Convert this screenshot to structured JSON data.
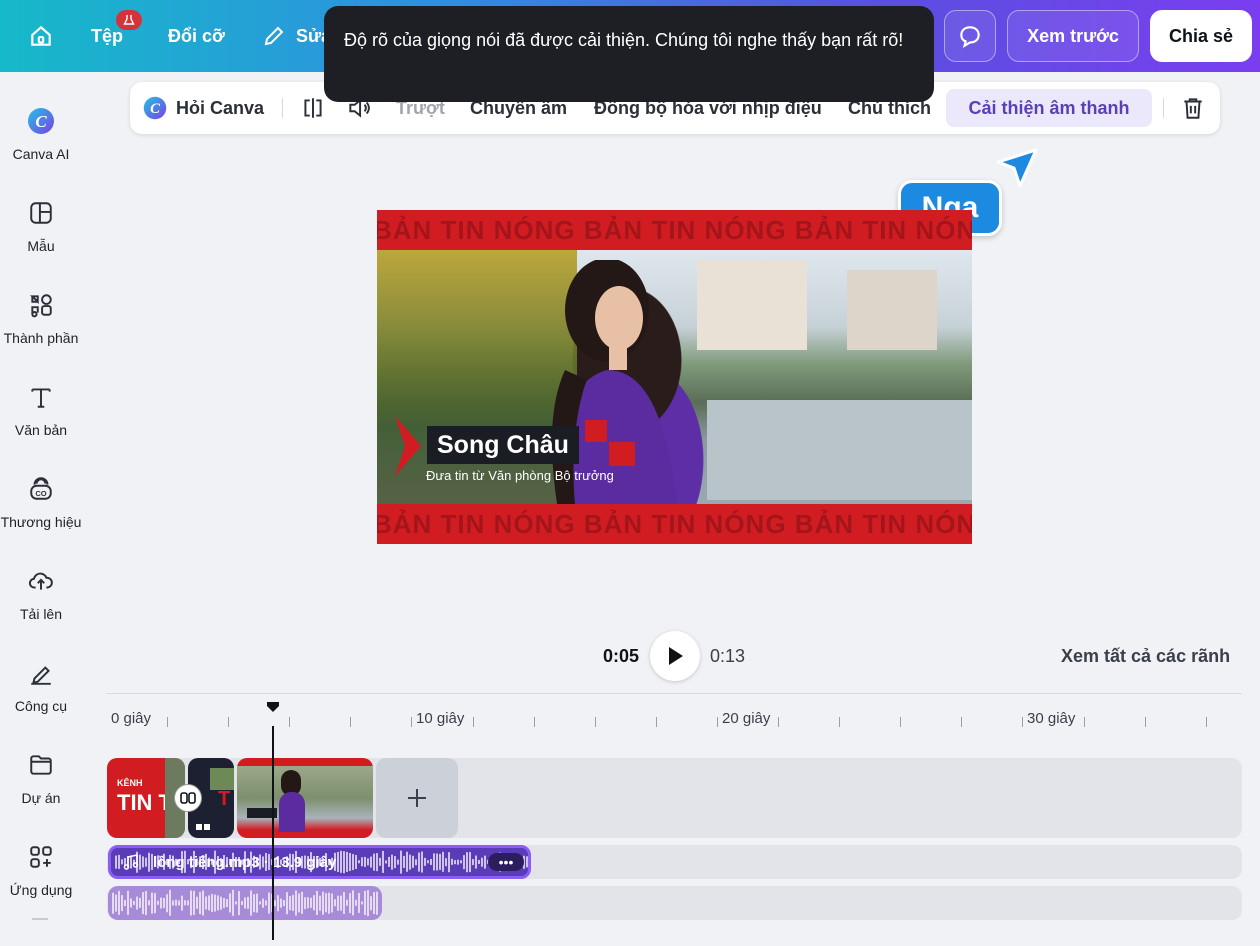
{
  "topbar": {
    "file_label": "Tệp",
    "resize_label": "Đổi cỡ",
    "edit_label": "Sửa",
    "preview_label": "Xem trước",
    "share_label": "Chia sẻ"
  },
  "toast": {
    "message": "Độ rõ của giọng nói đã được cải thiện. Chúng tôi nghe thấy bạn rất rõ!"
  },
  "sidebar": {
    "items": [
      {
        "label": "Canva AI",
        "icon": "canva-ai-icon"
      },
      {
        "label": "Mẫu",
        "icon": "template-icon"
      },
      {
        "label": "Thành phần",
        "icon": "elements-icon"
      },
      {
        "label": "Văn bản",
        "icon": "text-icon"
      },
      {
        "label": "Thương hiệu",
        "icon": "brand-icon"
      },
      {
        "label": "Tải lên",
        "icon": "upload-icon"
      },
      {
        "label": "Công cụ",
        "icon": "tools-icon"
      },
      {
        "label": "Dự án",
        "icon": "folder-icon"
      },
      {
        "label": "Ứng dụng",
        "icon": "apps-icon"
      }
    ]
  },
  "context_toolbar": {
    "ask_canva": "Hỏi Canva",
    "slide": "Trượt",
    "transcribe": "Chuyển âm",
    "beat_sync": "Đồng bộ hóa với nhịp điệu",
    "captions": "Chú thích",
    "enhance_audio": "Cải thiện âm thanh"
  },
  "collaborator": {
    "name": "Nga",
    "color": "#1c8ae0"
  },
  "canvas": {
    "band_text": "BẢN TIN NÓNG BẢN TIN NÓNG BẢN TIN NÓNG",
    "name": "Song Châu",
    "subtitle": "Đưa tin từ Văn phòng Bộ trưởng",
    "accent": "#d11c22"
  },
  "playback": {
    "current": "0:05",
    "total": "0:13",
    "see_all": "Xem tất cả các rãnh"
  },
  "timeline": {
    "labels": [
      "0 giây",
      "10 giây",
      "20 giây",
      "30 giây"
    ],
    "clip1_text": "TIN T",
    "clip1_small": "KÊNH",
    "audio_name": "lồng tiếng.mp3",
    "audio_duration": "13.9 giây",
    "audio_label": "lồng tiếng.mp3 · 13.9 giây"
  },
  "colors": {
    "gradient_start": "#16b9c9",
    "gradient_end": "#7a3ef0",
    "audio_primary": "#5a3bb8",
    "audio_secondary": "#a78bd9"
  }
}
